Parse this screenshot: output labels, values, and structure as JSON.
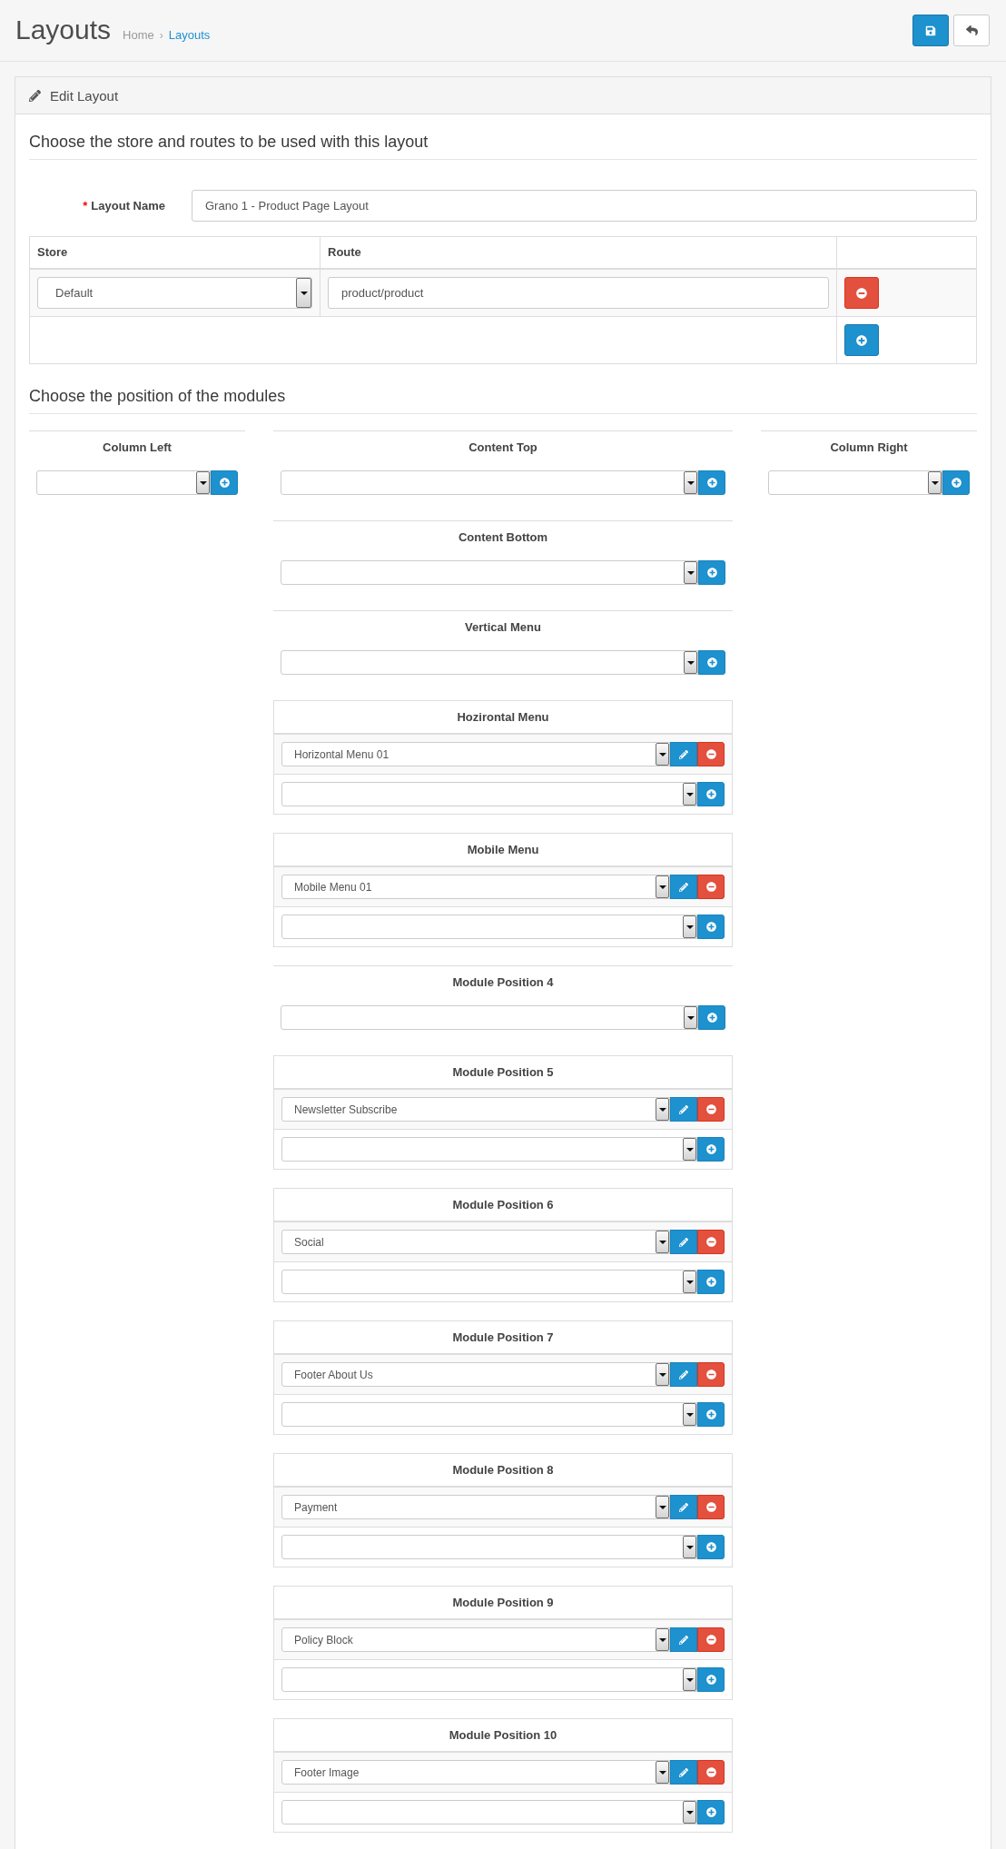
{
  "header": {
    "title": "Layouts",
    "breadcrumb": [
      {
        "label": "Home",
        "active": false
      },
      {
        "label": "Layouts",
        "active": true
      }
    ],
    "breadcrumb_separator": "›"
  },
  "panel": {
    "title": "Edit Layout"
  },
  "route_section": {
    "title": "Choose the store and routes to be used with this layout"
  },
  "layout_name": {
    "required_mark": "*",
    "label": "Layout Name",
    "value": "Grano 1 - Product Page Layout"
  },
  "routes_table": {
    "columns": [
      "Store",
      "Route"
    ],
    "rows": [
      {
        "store": "Default",
        "route": "product/product"
      }
    ]
  },
  "module_section": {
    "title": "Choose the position of the modules"
  },
  "positions": {
    "left_column": [
      {
        "title": "Column Left"
      }
    ],
    "center_column": [
      {
        "title": "Content Top"
      },
      {
        "title": "Content Bottom"
      },
      {
        "title": "Vertical Menu"
      },
      {
        "title": "Hozirontal Menu",
        "modules": [
          {
            "name": "Horizontal Menu 01"
          }
        ]
      },
      {
        "title": "Mobile Menu",
        "modules": [
          {
            "name": "Mobile Menu 01"
          }
        ]
      },
      {
        "title": "Module Position 4"
      },
      {
        "title": "Module Position 5",
        "modules": [
          {
            "name": "Newsletter Subscribe"
          }
        ]
      },
      {
        "title": "Module Position 6",
        "modules": [
          {
            "name": "Social"
          }
        ]
      },
      {
        "title": "Module Position 7",
        "modules": [
          {
            "name": "Footer About Us"
          }
        ]
      },
      {
        "title": "Module Position 8",
        "modules": [
          {
            "name": "Payment"
          }
        ]
      },
      {
        "title": "Module Position 9",
        "modules": [
          {
            "name": "Policy Block"
          }
        ]
      },
      {
        "title": "Module Position 10",
        "modules": [
          {
            "name": "Footer Image"
          }
        ]
      }
    ],
    "right_column": [
      {
        "title": "Column Right"
      }
    ]
  }
}
